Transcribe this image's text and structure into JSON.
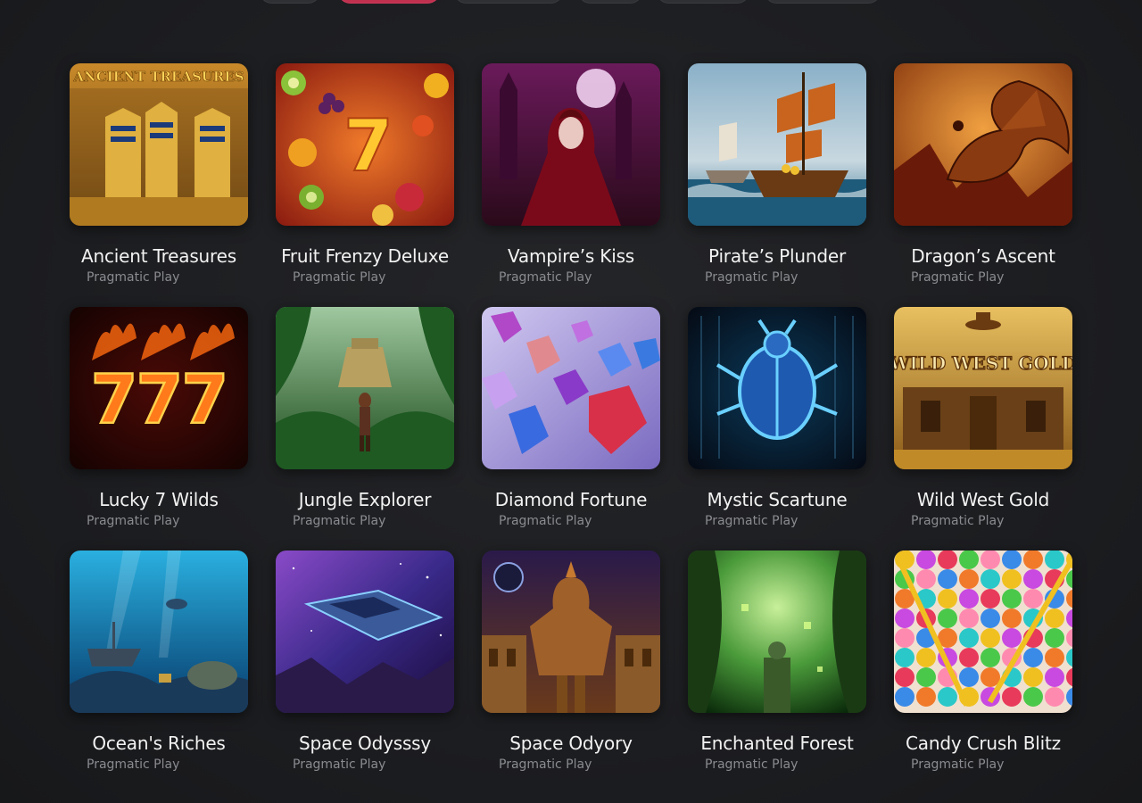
{
  "filters": [
    {
      "label": "",
      "active": false
    },
    {
      "label": "",
      "active": true
    },
    {
      "label": "",
      "active": false
    },
    {
      "label": "",
      "active": false
    },
    {
      "label": "",
      "active": false
    },
    {
      "label": "",
      "active": false
    }
  ],
  "games": [
    {
      "title": "Ancient Treasures",
      "provider": "Pragmatic Play",
      "art_text": "ANCIENT TREASURES"
    },
    {
      "title": "Fruit Frenzy Deluxe",
      "provider": "Pragmatic Play",
      "art_text": "7"
    },
    {
      "title": "Vampire’s Kiss",
      "provider": "Pragmatic Play"
    },
    {
      "title": "Pirate’s Plunder",
      "provider": "Pragmatic Play"
    },
    {
      "title": "Dragon’s Ascent",
      "provider": "Pragmatic Play"
    },
    {
      "title": "Lucky 7 Wilds",
      "provider": "Pragmatic Play",
      "art_text": "777"
    },
    {
      "title": "Jungle Explorer",
      "provider": "Pragmatic Play"
    },
    {
      "title": "Diamond Fortune",
      "provider": "Pragmatic Play"
    },
    {
      "title": "Mystic Scartune",
      "provider": "Pragmatic Play"
    },
    {
      "title": "Wild West Gold",
      "provider": "Pragmatic Play",
      "art_text": "WILD WEST GOLD"
    },
    {
      "title": "Ocean's Riches",
      "provider": "Pragmatic Play"
    },
    {
      "title": "Space Odysssy",
      "provider": "Pragmatic Play"
    },
    {
      "title": "Space Odyory",
      "provider": "Pragmatic Play"
    },
    {
      "title": "Enchanted Forest",
      "provider": "Pragmatic Play"
    },
    {
      "title": "Candy Crush Blitz",
      "provider": "Pragmatic Play"
    }
  ],
  "colors": {
    "background": "#1c1d20",
    "active_filter": "#c0314f",
    "title": "#f2f2f2",
    "provider": "#8a8b90"
  }
}
